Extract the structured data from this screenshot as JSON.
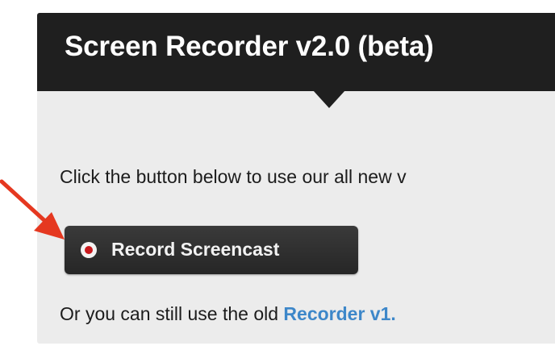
{
  "header": {
    "title": "Screen Recorder v2.0 (beta)"
  },
  "content": {
    "intro": "Click the button below to use our all new v",
    "record_button_label": "Record Screencast",
    "old_prefix": "Or you can still use the old ",
    "old_link": "Recorder v1."
  },
  "icons": {
    "record": "record-dot-icon",
    "annotation": "red-arrow-icon"
  },
  "colors": {
    "header_background": "#1f1f1f",
    "panel_background": "#ececec",
    "button_background": "#2f2f2f",
    "record_dot": "#c8191d",
    "link": "#3d87c9",
    "arrow": "#e53820"
  }
}
